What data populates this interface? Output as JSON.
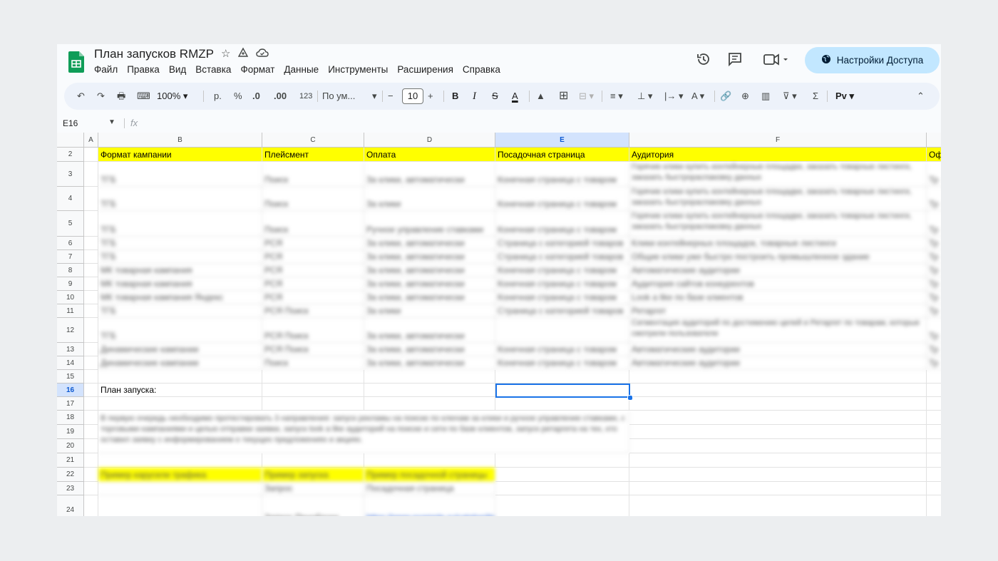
{
  "header": {
    "doc_title": "План запусков RMZP",
    "menu": [
      "Файл",
      "Правка",
      "Вид",
      "Вставка",
      "Формат",
      "Данные",
      "Инструменты",
      "Расширения",
      "Справка"
    ],
    "share_label": "Настройки Доступа",
    "icons": [
      "star-icon",
      "move-to-drive-icon",
      "cloud-status-icon",
      "history-icon",
      "comment-icon",
      "meet-icon"
    ]
  },
  "toolbar": {
    "zoom": "100%",
    "currency": "р.",
    "percent": "%",
    "dec_decrease": ".0",
    "dec_increase": ".00",
    "number_format": "123",
    "font": "По ум...",
    "font_size": "10",
    "bold": "B",
    "italic": "I",
    "strike": "S",
    "text_color": "A",
    "sigma": "Σ",
    "input_tools": "Pv"
  },
  "formula_bar": {
    "name_box": "E16",
    "fx": "fx"
  },
  "grid": {
    "columns": [
      "A",
      "B",
      "C",
      "D",
      "E",
      "F"
    ],
    "rows": [
      "2",
      "3",
      "4",
      "5",
      "6",
      "7",
      "8",
      "9",
      "10",
      "11",
      "12",
      "13",
      "14",
      "15",
      "16",
      "17",
      "18",
      "19",
      "20",
      "21",
      "22",
      "23",
      "24"
    ],
    "header_row": [
      "Формат кампании",
      "Плейсмент",
      "Оплата",
      "Посадочная страница",
      "Аудитория",
      "Оф"
    ],
    "plan_label": "План запуска:",
    "blurred_rows": [
      [
        "ТГБ",
        "Поиск",
        "За клики, автоматически",
        "Конечная страница с товаром",
        "Горячие клики купить контейнерные площадки, заказать товарные листинги, заказать быстрораспаковку данных"
      ],
      [
        "ТГБ",
        "Поиск",
        "За клики",
        "Конечная страница с товаром",
        "Горячие клики купить контейнерные площадки, заказать товарные листинги, заказать быстрораспаковку данных"
      ],
      [
        "ТГБ",
        "Поиск",
        "Ручное управление ставками",
        "Конечная страница с товаром",
        "Горячие клики купить контейнерные площадки, заказать товарные листинги, заказать быстрораспаковку данных"
      ],
      [
        "ТГБ",
        "РСЯ",
        "За клики, автоматически",
        "Страница с категорией товаров",
        "Клики контейнерных площадок, товарные листинги"
      ],
      [
        "ТГБ",
        "РСЯ",
        "За клики, автоматически",
        "Страница с категорией товаров",
        "Общие клики уже быстро построить промышленное здание"
      ],
      [
        "МК товарная кампания",
        "РСЯ",
        "За клики, автоматически",
        "Конечная страница с товаром",
        "Автоматические аудитории"
      ],
      [
        "МК товарная кампания",
        "РСЯ",
        "За клики, автоматически",
        "Конечная страница с товаром",
        "Аудитория сайтов конкурентов"
      ],
      [
        "МК товарная кампания Яндекс",
        "РСЯ",
        "За клики, автоматически",
        "Конечная страница с товаром",
        "Look a like по базе клиентов"
      ],
      [
        "ТГБ",
        "РСЯ Поиск",
        "За клики",
        "Страница с категорией товаров",
        "Ретаргет"
      ],
      [
        "ТГБ",
        "РСЯ Поиск",
        "За клики, автоматически",
        "",
        "Сегментация аудиторий по достижению целей и Ретаргет по товарам, которые смотрели пользователи"
      ],
      [
        "Динамические кампании",
        "РСЯ Поиск",
        "За клики, автоматически",
        "Конечная страница с товаром",
        "Автоматические аудитории"
      ],
      [
        "Динамические кампании",
        "Поиск",
        "За клики, автоматически",
        "Конечная страница с товаром",
        "Автоматические аудитории"
      ]
    ],
    "blurred_paragraph": "В первую очередь необходимо протестировать 3 направления: запуск рекламы на поиске по ключам за клики и ручное управление ставками, с торговыми кампаниями и целью отправки заявки, запуск look a like аудиторий на поиске и сети по базе клиентов, запуск ретаргета на тех, кто оставил заявку с информированием о текущих предложениях и акциях.",
    "example_header": [
      "Пример карусели трафика",
      "Пример запуска",
      "Пример посадочной страницы"
    ],
    "example_rows": [
      [
        "",
        "Запрос",
        "Посадочная страница"
      ],
      [
        "",
        "Запрос Пеноблоки",
        "https://www.example.ru/catalog/item"
      ]
    ]
  }
}
